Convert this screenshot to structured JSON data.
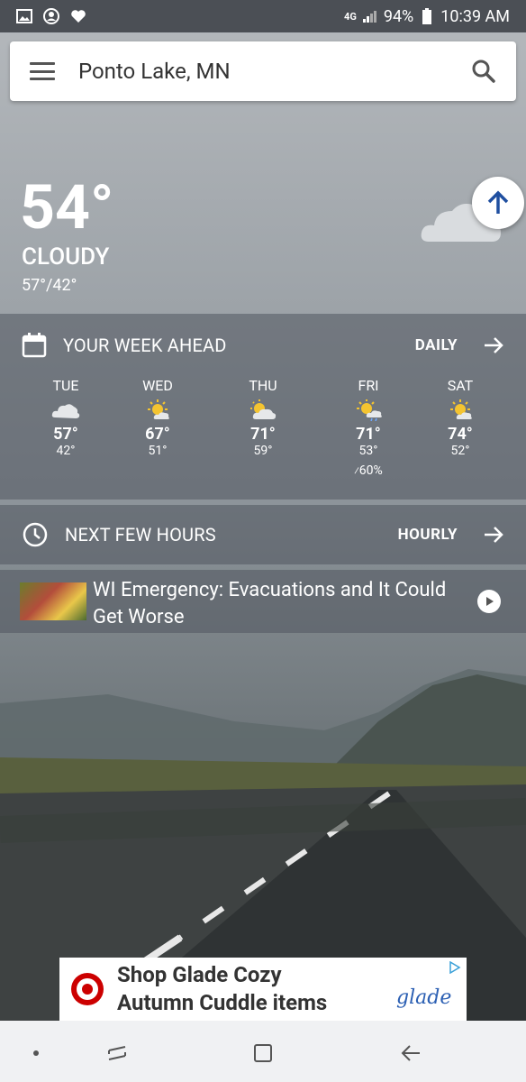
{
  "status_bar": {
    "network": "4G",
    "battery": "94%",
    "time": "10:39 AM",
    "left_icons": [
      "image-icon",
      "account-circle-icon",
      "heart-icon"
    ]
  },
  "search": {
    "location": "Ponto Lake, MN"
  },
  "current": {
    "temperature": "54°",
    "condition": "CLOUDY",
    "hi_lo": "57°/42°",
    "icon": "cloudy-icon"
  },
  "week": {
    "title": "YOUR WEEK AHEAD",
    "link_label": "DAILY",
    "days": [
      {
        "name": "TUE",
        "hi": "57°",
        "lo": "42°",
        "icon": "cloudy-icon",
        "pop": ""
      },
      {
        "name": "WED",
        "hi": "67°",
        "lo": "51°",
        "icon": "partly-sunny-icon",
        "pop": ""
      },
      {
        "name": "THU",
        "hi": "71°",
        "lo": "59°",
        "icon": "partly-cloudy-icon",
        "pop": ""
      },
      {
        "name": "FRI",
        "hi": "71°",
        "lo": "53°",
        "icon": "sun-rain-icon",
        "pop": "60%"
      },
      {
        "name": "SAT",
        "hi": "74°",
        "lo": "52°",
        "icon": "partly-sunny-icon",
        "pop": ""
      }
    ]
  },
  "hours": {
    "title": "NEXT FEW HOURS",
    "link_label": "HOURLY"
  },
  "news": {
    "headline": "WI Emergency: Evacuations and It Could Get Worse"
  },
  "ad": {
    "text_line1": "Shop Glade Cozy",
    "text_line2": "Autumn Cuddle items",
    "brand": "glade",
    "accent": "#cc0000"
  },
  "colors": {
    "panel": "#50565e",
    "fab_arrow": "#1f4fa0",
    "status_bar": "#4b4f55"
  }
}
